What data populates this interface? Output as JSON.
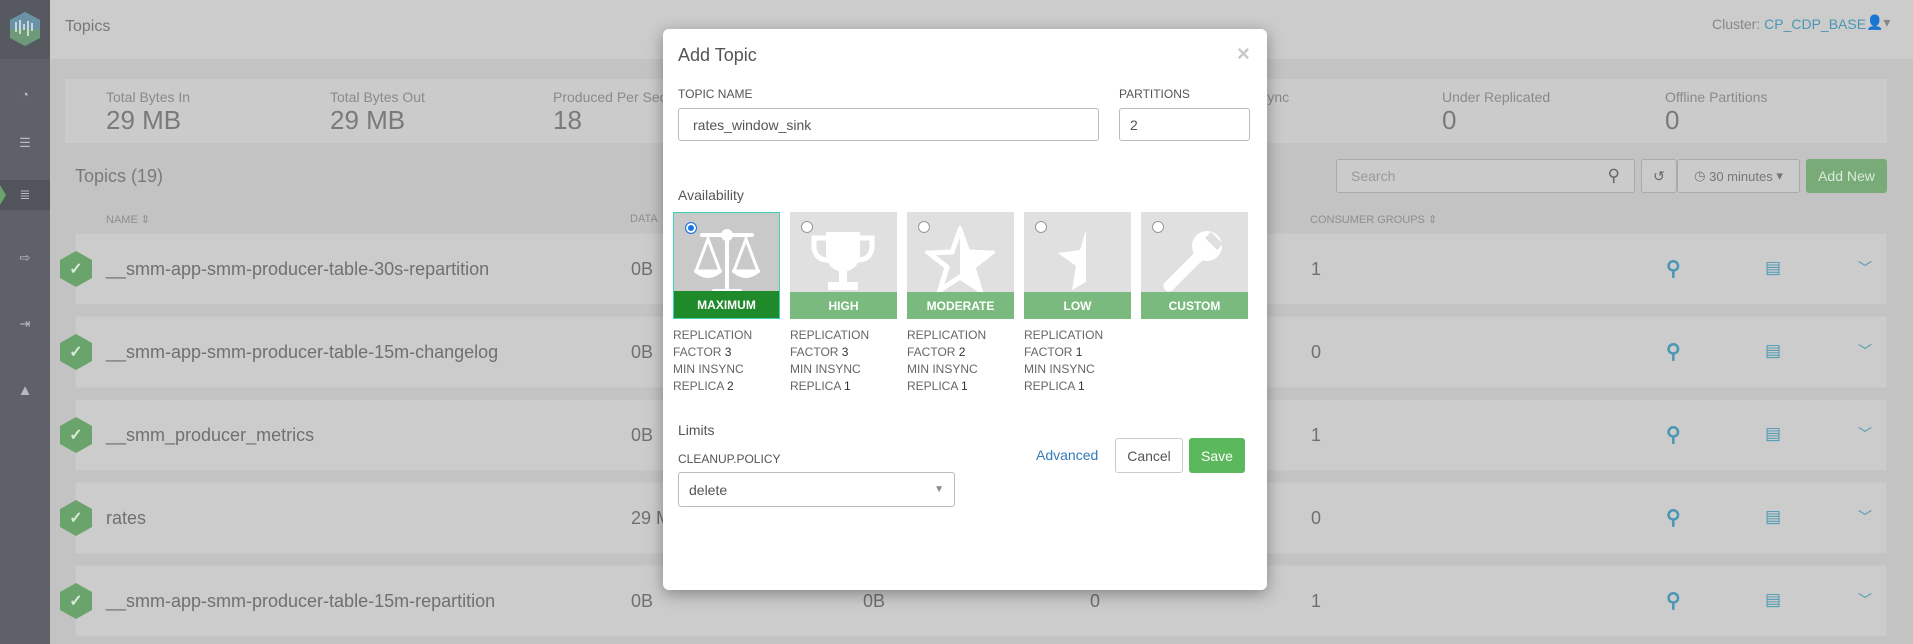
{
  "header": {
    "title": "Topics",
    "cluster_label": "Cluster:",
    "cluster_name": "CP_CDP_BASE"
  },
  "sidebar": {
    "items": [
      "dashboard-icon",
      "brokers-icon",
      "topics-icon",
      "producers-icon",
      "consumers-icon",
      "alerts-icon"
    ],
    "active": "topics-icon"
  },
  "stats": [
    {
      "label": "Total Bytes In",
      "value": "29 MB"
    },
    {
      "label": "Total Bytes Out",
      "value": "29 MB"
    },
    {
      "label": "Produced Per Sec",
      "value": "18"
    },
    {
      "label": "Sync",
      "value": ""
    },
    {
      "label": "Under Replicated",
      "value": "0"
    },
    {
      "label": "Offline Partitions",
      "value": "0"
    }
  ],
  "topics": {
    "title": "Topics (19)",
    "search_placeholder": "Search",
    "time_range": "30 minutes",
    "add_new": "Add New",
    "columns": {
      "name": "NAME",
      "data": "DATA",
      "consumer_groups": "CONSUMER GROUPS"
    },
    "rows": [
      {
        "name": "__smm-app-smm-producer-table-30s-repartition",
        "data": "0B",
        "col2": "",
        "col3": "",
        "consumer_groups": "1"
      },
      {
        "name": "__smm-app-smm-producer-table-15m-changelog",
        "data": "0B",
        "col2": "",
        "col3": "",
        "consumer_groups": "0"
      },
      {
        "name": "__smm_producer_metrics",
        "data": "0B",
        "col2": "",
        "col3": "",
        "consumer_groups": "1"
      },
      {
        "name": "rates",
        "data": "29 M",
        "col2": "",
        "col3": "",
        "consumer_groups": "0"
      },
      {
        "name": "__smm-app-smm-producer-table-15m-repartition",
        "data": "0B",
        "col2": "0B",
        "col3": "0",
        "consumer_groups": "1"
      }
    ]
  },
  "modal": {
    "title": "Add Topic",
    "close": "×",
    "topic_name_label": "TOPIC NAME",
    "topic_name_value": "rates_window_sink",
    "partitions_label": "PARTITIONS",
    "partitions_value": "2",
    "availability_label": "Availability",
    "options": [
      {
        "label": "MAXIMUM",
        "icon": "scales-icon",
        "selected": true,
        "l1": "REPLICATION",
        "l2": "FACTOR ",
        "v2": "3",
        "l3": "MIN INSYNC",
        "l4": "REPLICA ",
        "v4": "2"
      },
      {
        "label": "HIGH",
        "icon": "trophy-icon",
        "selected": false,
        "l1": "REPLICATION",
        "l2": "FACTOR ",
        "v2": "3",
        "l3": "MIN INSYNC",
        "l4": "REPLICA ",
        "v4": "1"
      },
      {
        "label": "MODERATE",
        "icon": "half-star-icon",
        "selected": false,
        "l1": "REPLICATION",
        "l2": "FACTOR ",
        "v2": "2",
        "l3": "MIN INSYNC",
        "l4": "REPLICA ",
        "v4": "1"
      },
      {
        "label": "LOW",
        "icon": "quarter-star-icon",
        "selected": false,
        "l1": "REPLICATION",
        "l2": "FACTOR ",
        "v2": "1",
        "l3": "MIN INSYNC",
        "l4": "REPLICA ",
        "v4": "1"
      },
      {
        "label": "CUSTOM",
        "icon": "wrench-icon",
        "selected": false
      }
    ],
    "limits_label": "Limits",
    "cleanup_label": "CLEANUP.POLICY",
    "cleanup_value": "delete",
    "advanced": "Advanced",
    "cancel": "Cancel",
    "save": "Save"
  },
  "colors": {
    "accent_green": "#5cb85c",
    "selected_band": "#1e8a2a",
    "band": "#7aba7e",
    "link": "#337ab7",
    "teal": "#4a97b3"
  }
}
